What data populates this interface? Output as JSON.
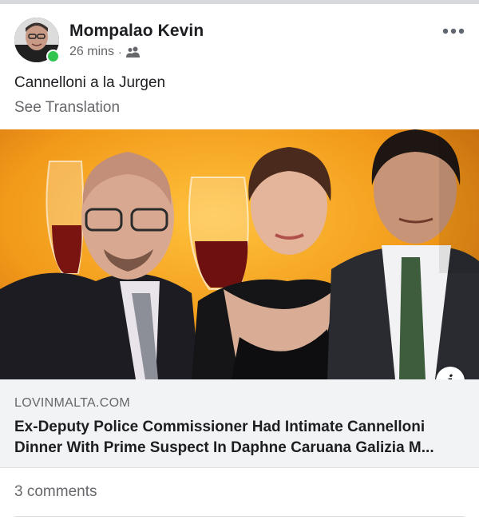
{
  "post": {
    "author": "Mompalao Kevin",
    "timestamp": "26 mins",
    "separator": "·",
    "audience_icon": "friends-icon",
    "online": true,
    "text": "Cannelloni a la Jurgen",
    "see_translation": "See Translation",
    "more_icon": "more-dots-icon"
  },
  "link": {
    "domain": "LOVINMALTA.COM",
    "title": "Ex-Deputy Police Commissioner Had Intimate Cannelloni Dinner With Prime Suspect In Daphne Caruana Galizia M...",
    "info_glyph": "i"
  },
  "footer": {
    "comments": "3 comments"
  },
  "colors": {
    "online_green": "#31c44f",
    "secondary_text": "#65676b",
    "link_meta_bg": "#f2f3f5",
    "image_bg_orange": "#f29a1a"
  }
}
